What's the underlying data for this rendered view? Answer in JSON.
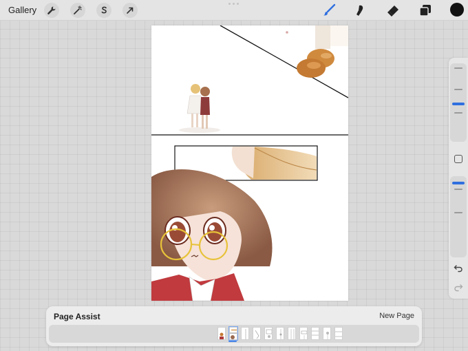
{
  "topbar": {
    "gallery_label": "Gallery",
    "left_tools": [
      {
        "name": "wrench-icon"
      },
      {
        "name": "magic-wand-icon"
      },
      {
        "name": "selection-icon"
      },
      {
        "name": "transform-arrow-icon"
      }
    ],
    "right_tools": [
      {
        "name": "brush-icon",
        "active": true
      },
      {
        "name": "smudge-icon"
      },
      {
        "name": "eraser-icon"
      },
      {
        "name": "layers-icon"
      }
    ],
    "current_color": "#111111",
    "accent_color": "#2f6fe0"
  },
  "sidebar": {
    "brush_size_level": 0.35,
    "opacity_level": 0.0,
    "icons": [
      "modify-square-icon",
      "undo-icon",
      "redo-icon"
    ]
  },
  "page_assist": {
    "title": "Page Assist",
    "new_page_label": "New Page",
    "page_count": 11,
    "active_page": 2
  }
}
